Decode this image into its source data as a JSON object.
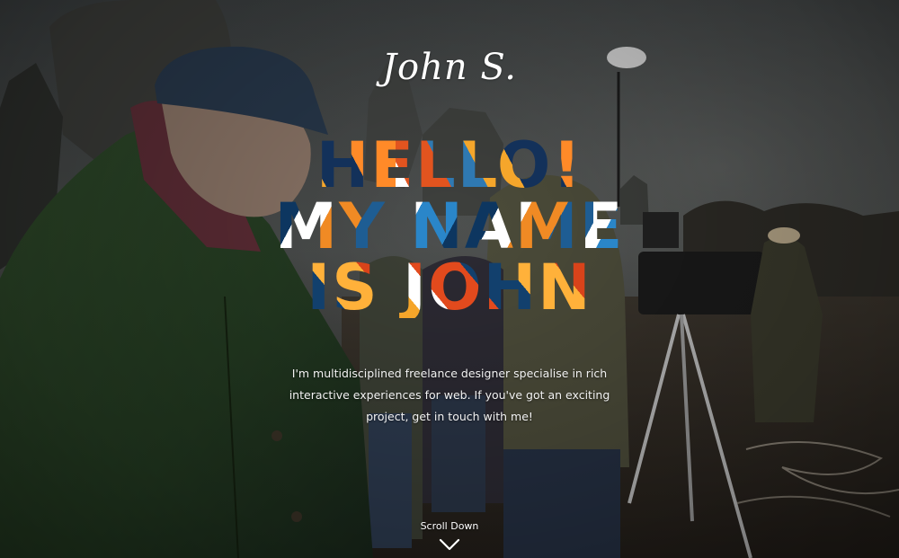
{
  "logo": {
    "text": "John S."
  },
  "hero": {
    "headline_lines": [
      "HELLO!",
      "MY NAME",
      "IS JOHN"
    ],
    "intro": "I'm multidisciplined freelance designer specialise in rich interactive experiences for web. If you've got an exciting project, get in touch with me!",
    "scroll_label": "Scroll Down",
    "scroll_icon": "chevron-down-icon"
  },
  "colors": {
    "text": "#ffffff",
    "headline_orange": "#f07a1c",
    "headline_navy": "#0c3a63",
    "headline_blue": "#2a86c9",
    "headline_red": "#e24a1d"
  }
}
